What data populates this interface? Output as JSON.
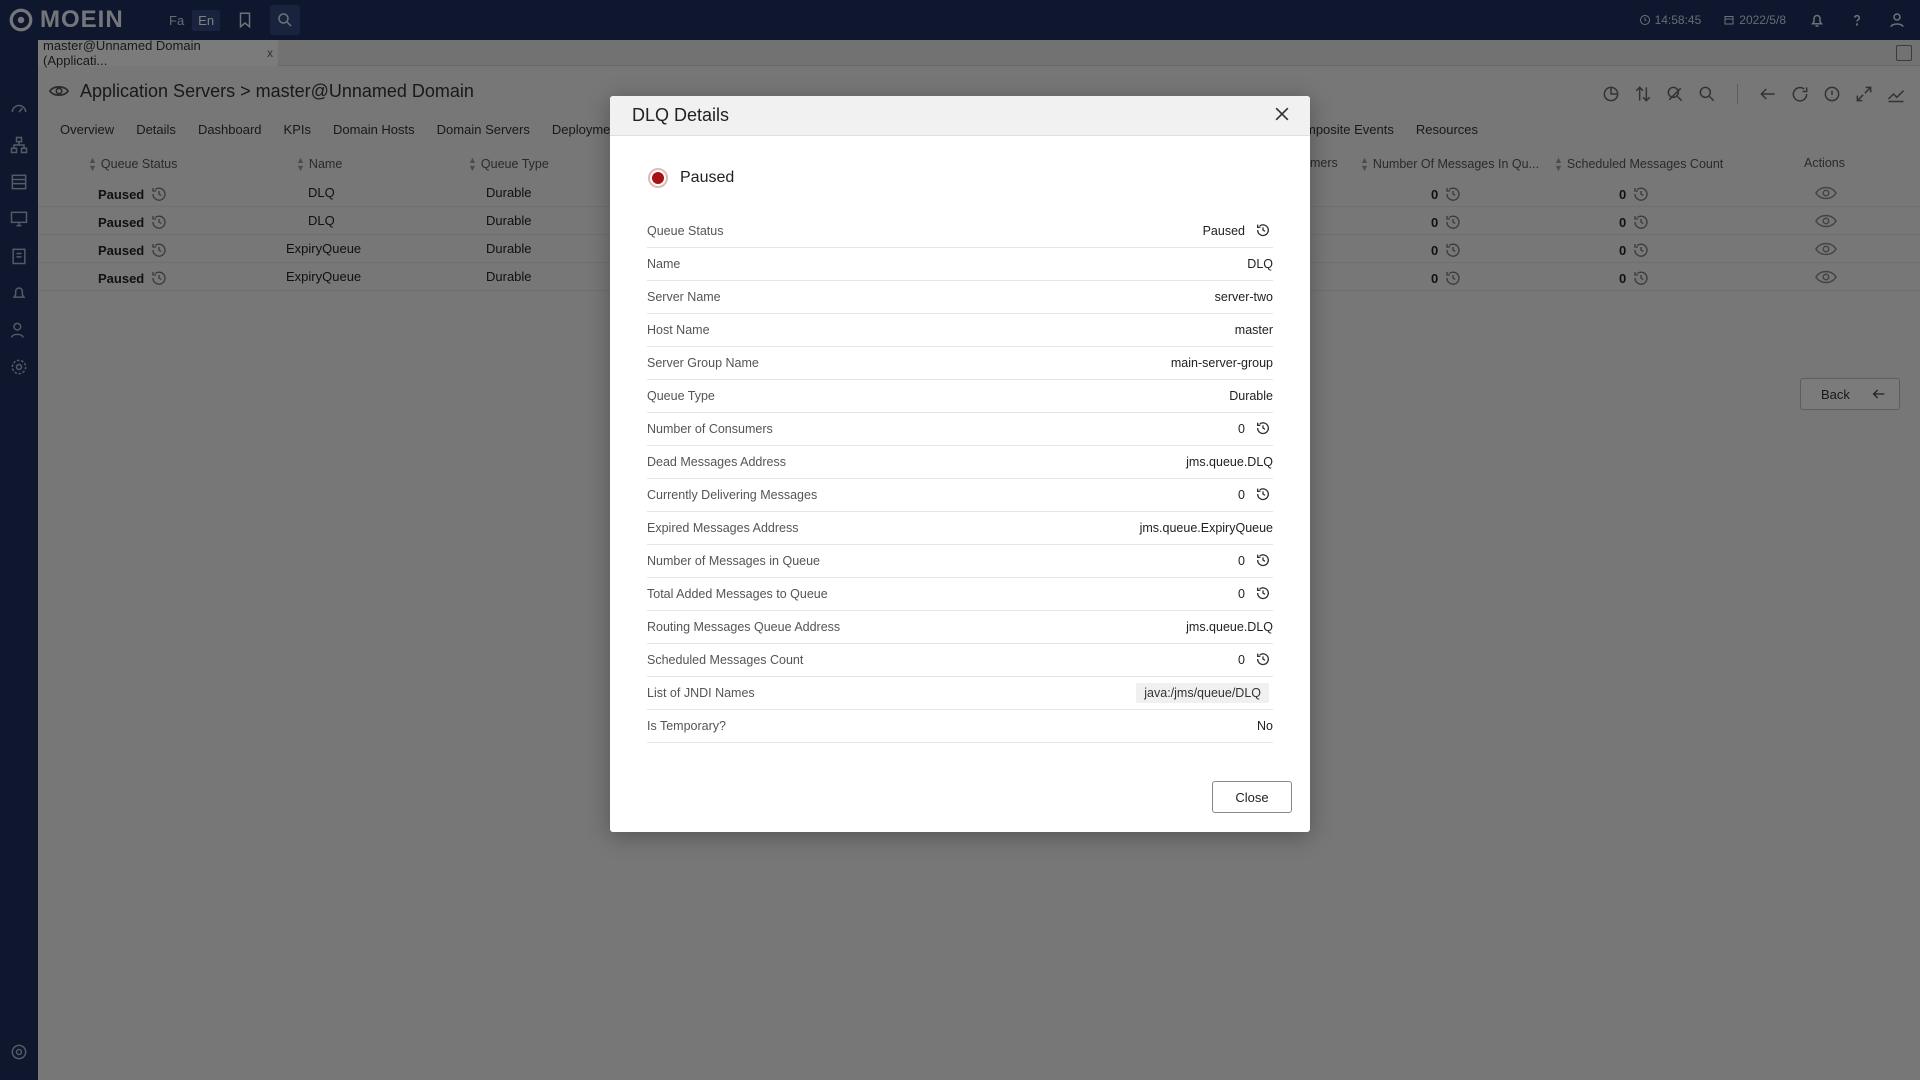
{
  "app": {
    "logo_text": "MOEIN",
    "lang_fa": "Fa",
    "lang_en": "En",
    "time": "14:58:45",
    "date": "2022/5/8"
  },
  "doc_tab": {
    "label": "master@Unnamed Domain (Applicati...",
    "close": "x"
  },
  "page": {
    "title": "Application Servers > master@Unnamed Domain"
  },
  "subtabs_left": [
    "Overview",
    "Details",
    "Dashboard",
    "KPIs",
    "Domain Hosts",
    "Domain Servers",
    "Deployments"
  ],
  "subtabs_right": [
    "mposite Events",
    "Resources"
  ],
  "table": {
    "headers": {
      "queue_status": "Queue Status",
      "name": "Name",
      "queue_type": "Queue Type",
      "consumers_partial": "mers",
      "messages_in_queue": "Number Of Messages In Qu...",
      "scheduled": "Scheduled Messages Count",
      "actions": "Actions"
    },
    "rows": [
      {
        "status": "Paused",
        "name": "DLQ",
        "type": "Durable",
        "messages": "0",
        "scheduled": "0"
      },
      {
        "status": "Paused",
        "name": "DLQ",
        "type": "Durable",
        "messages": "0",
        "scheduled": "0"
      },
      {
        "status": "Paused",
        "name": "ExpiryQueue",
        "type": "Durable",
        "messages": "0",
        "scheduled": "0"
      },
      {
        "status": "Paused",
        "name": "ExpiryQueue",
        "type": "Durable",
        "messages": "0",
        "scheduled": "0"
      }
    ]
  },
  "back_button": {
    "label": "Back"
  },
  "modal": {
    "title": "DLQ Details",
    "status": "Paused",
    "status_color": "#a81212",
    "fields": [
      {
        "label": "Queue Status",
        "value": "Paused"
      },
      {
        "label": "Name",
        "value": "DLQ"
      },
      {
        "label": "Server Name",
        "value": "server-two"
      },
      {
        "label": "Host Name",
        "value": "master"
      },
      {
        "label": "Server Group Name",
        "value": "main-server-group"
      },
      {
        "label": "Queue Type",
        "value": "Durable"
      },
      {
        "label": "Number of Consumers",
        "value": "0"
      },
      {
        "label": "Dead Messages Address",
        "value": "jms.queue.DLQ"
      },
      {
        "label": "Currently Delivering Messages",
        "value": "0"
      },
      {
        "label": "Expired Messages Address",
        "value": "jms.queue.ExpiryQueue"
      },
      {
        "label": "Number of Messages in Queue",
        "value": "0"
      },
      {
        "label": "Total Added Messages to Queue",
        "value": "0"
      },
      {
        "label": "Routing Messages Queue Address",
        "value": "jms.queue.DLQ"
      },
      {
        "label": "Scheduled Messages Count",
        "value": "0"
      },
      {
        "label": "List of JNDI Names",
        "value": "java:/jms/queue/DLQ"
      },
      {
        "label": "Is Temporary?",
        "value": "No"
      }
    ],
    "close_label": "Close"
  }
}
